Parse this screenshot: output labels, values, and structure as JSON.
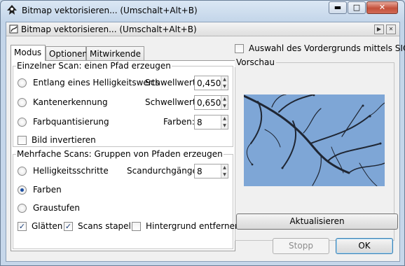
{
  "window": {
    "title": "Bitmap vektorisieren... (Umschalt+Alt+B)",
    "controls": {
      "minimize": "▬",
      "maximize": "□",
      "close": "✕"
    }
  },
  "dock": {
    "title": "Bitmap vektorisieren... (Umschalt+Alt+B)",
    "buttons": {
      "float": "▶",
      "close": "✕"
    }
  },
  "tabs": [
    {
      "label": "Modus",
      "active": true
    },
    {
      "label": "Optionen",
      "active": false
    },
    {
      "label": "Mitwirkende",
      "active": false
    }
  ],
  "siox": {
    "label": "Auswahl des Vordergrunds mittels SIOX",
    "checked": false
  },
  "single_scan": {
    "title": "Einzelner Scan: einen Pfad erzeugen",
    "options": [
      {
        "label": "Entlang eines Helligkeitswerts",
        "selected": false,
        "param_label": "Schwellwert:",
        "param_value": "0,450"
      },
      {
        "label": "Kantenerkennung",
        "selected": false,
        "param_label": "Schwellwert:",
        "param_value": "0,650"
      },
      {
        "label": "Farbquantisierung",
        "selected": false,
        "param_label": "Farben:",
        "param_value": "8"
      }
    ],
    "invert": {
      "label": "Bild invertieren",
      "checked": false
    }
  },
  "multi_scan": {
    "title": "Mehrfache Scans: Gruppen von Pfaden erzeugen",
    "options": [
      {
        "label": "Helligkeitsschritte",
        "selected": false
      },
      {
        "label": "Farben",
        "selected": true
      },
      {
        "label": "Graustufen",
        "selected": false
      }
    ],
    "passes_label": "Scandurchgänge:",
    "passes_value": "8",
    "smooth": {
      "label": "Glätten",
      "checked": true
    },
    "stack": {
      "label": "Scans stapeln",
      "checked": true
    },
    "remove_bg": {
      "label": "Hintergrund entfernen",
      "checked": false
    }
  },
  "preview": {
    "title": "Vorschau",
    "update_label": "Aktualisieren"
  },
  "footer": {
    "stop_label": "Stopp",
    "ok_label": "OK"
  },
  "icons": {
    "check": "✓",
    "spin_up": "▲",
    "spin_down": "▼"
  },
  "colors": {
    "sky": "#7ea6d6",
    "branch": "#1f2633",
    "selected_radio": "#1d4fa1"
  }
}
